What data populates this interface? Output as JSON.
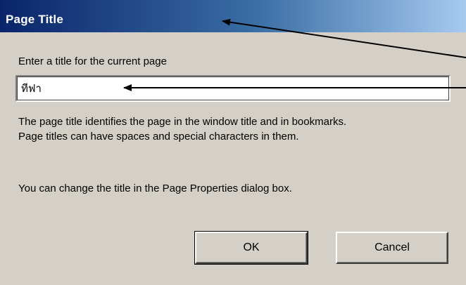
{
  "window": {
    "title": "Page Title"
  },
  "dialog": {
    "prompt": "Enter a title for the current page",
    "input_value": "ทีฟา",
    "description_line1": "The page title identifies the page in the window title and in bookmarks.",
    "description_line2": "Page titles can have spaces and special characters in them.",
    "description2": "You can change the title in the Page Properties dialog box."
  },
  "buttons": {
    "ok_label": "OK",
    "cancel_label": "Cancel"
  },
  "colors": {
    "titlebar_start": "#0a246a",
    "titlebar_end": "#a6caf0",
    "dialog_bg": "#d4d0c8"
  }
}
